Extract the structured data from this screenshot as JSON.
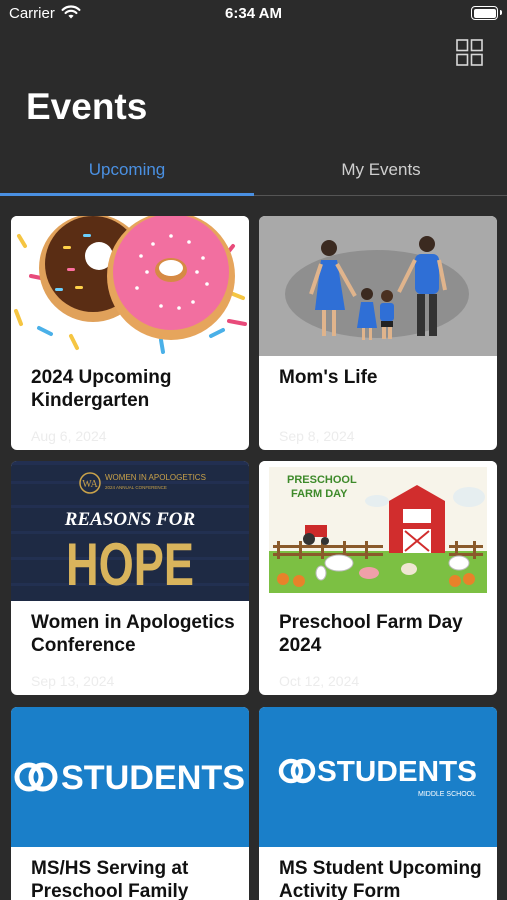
{
  "status_bar": {
    "carrier": "Carrier",
    "time": "6:34 AM"
  },
  "header": {
    "title": "Events"
  },
  "tabs": [
    {
      "label": "Upcoming",
      "active": true
    },
    {
      "label": "My Events",
      "active": false
    }
  ],
  "events": [
    {
      "title": "2024 Upcoming Kindergarten",
      "date": "Aug 6, 2024"
    },
    {
      "title": "Mom's Life",
      "date": "Sep 8, 2024"
    },
    {
      "title": "Women in Apologetics Conference",
      "date": "Sep 13, 2024",
      "image_text": {
        "org": "WOMEN IN APOLOGETICS",
        "sub": "2024 ANNUAL CONFERENCE",
        "line1": "REASONS FOR",
        "line2": "HOPE"
      }
    },
    {
      "title": "Preschool Farm Day 2024",
      "date": "Oct 12, 2024",
      "image_text": {
        "line1": "PRESCHOOL",
        "line2": "FARM DAY"
      }
    },
    {
      "title": "MS/HS Serving at Preschool Family",
      "date": "",
      "image_text": {
        "logo": "STUDENTS"
      }
    },
    {
      "title": "MS Student Upcoming Activity Form",
      "date": "",
      "image_text": {
        "logo": "STUDENTS",
        "sub": "MIDDLE SCHOOL"
      }
    }
  ],
  "colors": {
    "accent": "#4a90e2",
    "background": "#2b2b2b",
    "students_blue": "#1a7fc9"
  },
  "icons": {
    "wifi": "wifi-icon",
    "battery": "battery-icon",
    "layout": "grid-view-icon"
  }
}
